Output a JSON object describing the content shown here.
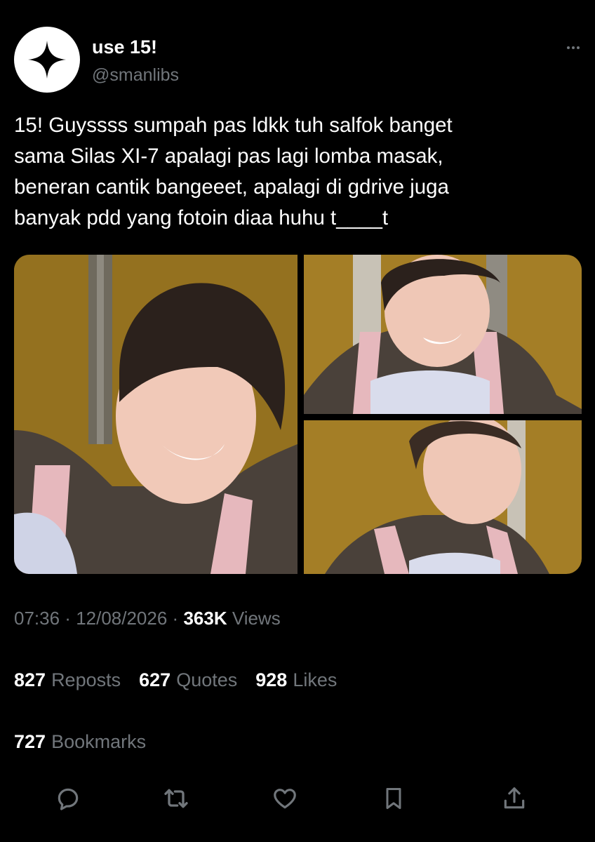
{
  "author": {
    "display_name": "use 15!",
    "handle": "@smanlibs",
    "avatar_icon": "sparkle-icon"
  },
  "tweet": {
    "text_lines": [
      "15! Guyssss sumpah pas ldkk tuh salfok banget",
      "sama Silas XI-7 apalagi pas lagi lomba masak,",
      "beneran cantik bangeeet, apalagi di gdrive juga",
      "banyak pdd yang fotoin diaa huhu t____t"
    ],
    "time": "07:36",
    "date": "12/08/2026",
    "views_count": "363K",
    "views_label": "Views"
  },
  "stats": {
    "reposts_count": "827",
    "reposts_label": "Reposts",
    "quotes_count": "627",
    "quotes_label": "Quotes",
    "likes_count": "928",
    "likes_label": "Likes",
    "bookmarks_count": "727",
    "bookmarks_label": "Bookmarks"
  },
  "actions": [
    "reply-icon",
    "repost-icon",
    "like-icon",
    "bookmark-icon",
    "share-icon"
  ],
  "colors": {
    "background": "#000000",
    "text_primary": "#ffffff",
    "text_secondary": "#71767b"
  }
}
